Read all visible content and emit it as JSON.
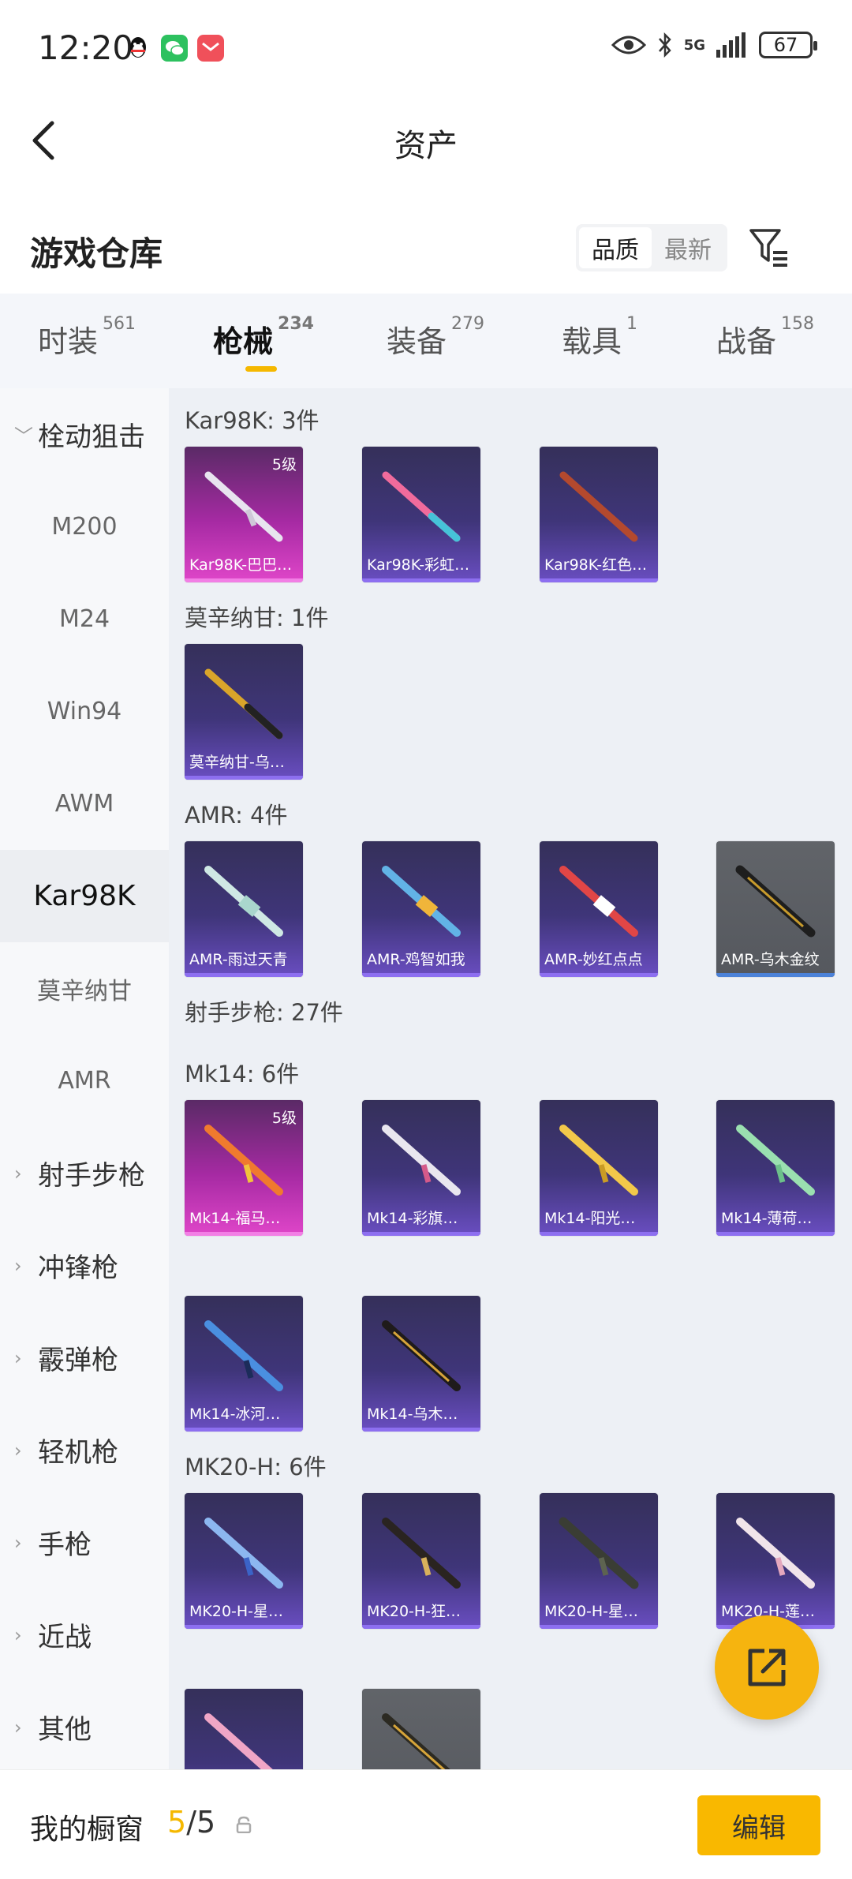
{
  "status": {
    "time": "12:20",
    "network": "5G",
    "battery": "67",
    "app_icons": [
      "qq-icon",
      "wechat-icon",
      "mail-icon"
    ]
  },
  "header": {
    "title": "资产"
  },
  "subheader": {
    "label": "游戏仓库",
    "sort_options": [
      "品质",
      "最新"
    ],
    "active_sort": "品质"
  },
  "tabs": [
    {
      "label": "时装",
      "count": "561"
    },
    {
      "label": "枪械",
      "count": "234"
    },
    {
      "label": "装备",
      "count": "279"
    },
    {
      "label": "载具",
      "count": "1"
    },
    {
      "label": "战备",
      "count": "158"
    }
  ],
  "active_tab": "枪械",
  "sidebar": [
    {
      "label": "栓动狙击",
      "type": "group",
      "expanded": true
    },
    {
      "label": "M200",
      "type": "item"
    },
    {
      "label": "M24",
      "type": "item"
    },
    {
      "label": "Win94",
      "type": "item"
    },
    {
      "label": "AWM",
      "type": "item"
    },
    {
      "label": "Kar98K",
      "type": "item",
      "active": true
    },
    {
      "label": "莫辛纳甘",
      "type": "item"
    },
    {
      "label": "AMR",
      "type": "item"
    },
    {
      "label": "射手步枪",
      "type": "group"
    },
    {
      "label": "冲锋枪",
      "type": "group"
    },
    {
      "label": "霰弹枪",
      "type": "group"
    },
    {
      "label": "轻机枪",
      "type": "group"
    },
    {
      "label": "手枪",
      "type": "group"
    },
    {
      "label": "近战",
      "type": "group"
    },
    {
      "label": "其他",
      "type": "group"
    }
  ],
  "sections": {
    "kar98k": {
      "label": "Kar98K: 3件",
      "items": [
        {
          "name": "Kar98K-巴巴…",
          "level": "5级",
          "rarity": "gold"
        },
        {
          "name": "Kar98K-彩虹…",
          "rarity": "purple"
        },
        {
          "name": "Kar98K-红色…",
          "rarity": "purple"
        }
      ]
    },
    "mosin": {
      "label": "莫辛纳甘: 1件",
      "items": [
        {
          "name": "莫辛纳甘-乌…",
          "rarity": "purple"
        }
      ]
    },
    "amr": {
      "label": "AMR: 4件",
      "items": [
        {
          "name": "AMR-雨过天青",
          "rarity": "purple"
        },
        {
          "name": "AMR-鸡智如我",
          "rarity": "purple"
        },
        {
          "name": "AMR-妙红点点",
          "rarity": "purple"
        },
        {
          "name": "AMR-乌木金纹",
          "rarity": "grey"
        }
      ]
    },
    "dmr": {
      "label": "射手步枪: 27件"
    },
    "mk14": {
      "label": "Mk14: 6件",
      "items": [
        {
          "name": "Mk14-福马…",
          "level": "5级",
          "rarity": "gold"
        },
        {
          "name": "Mk14-彩旗…",
          "rarity": "purple"
        },
        {
          "name": "Mk14-阳光…",
          "rarity": "purple"
        },
        {
          "name": "Mk14-薄荷…",
          "rarity": "purple"
        },
        {
          "name": "Mk14-冰河…",
          "rarity": "purple"
        },
        {
          "name": "Mk14-乌木…",
          "rarity": "purple"
        }
      ]
    },
    "mk20": {
      "label": "MK20-H: 6件",
      "items": [
        {
          "name": "MK20-H-星…",
          "rarity": "purple"
        },
        {
          "name": "MK20-H-狂…",
          "rarity": "purple"
        },
        {
          "name": "MK20-H-星…",
          "rarity": "purple"
        },
        {
          "name": "MK20-H-莲…",
          "rarity": "purple"
        },
        {
          "name": "",
          "rarity": "purple"
        },
        {
          "name": "",
          "rarity": "grey"
        }
      ]
    }
  },
  "bottom": {
    "label": "我的橱窗",
    "current": "5",
    "separator": "/",
    "total": "5",
    "edit_label": "编辑"
  }
}
